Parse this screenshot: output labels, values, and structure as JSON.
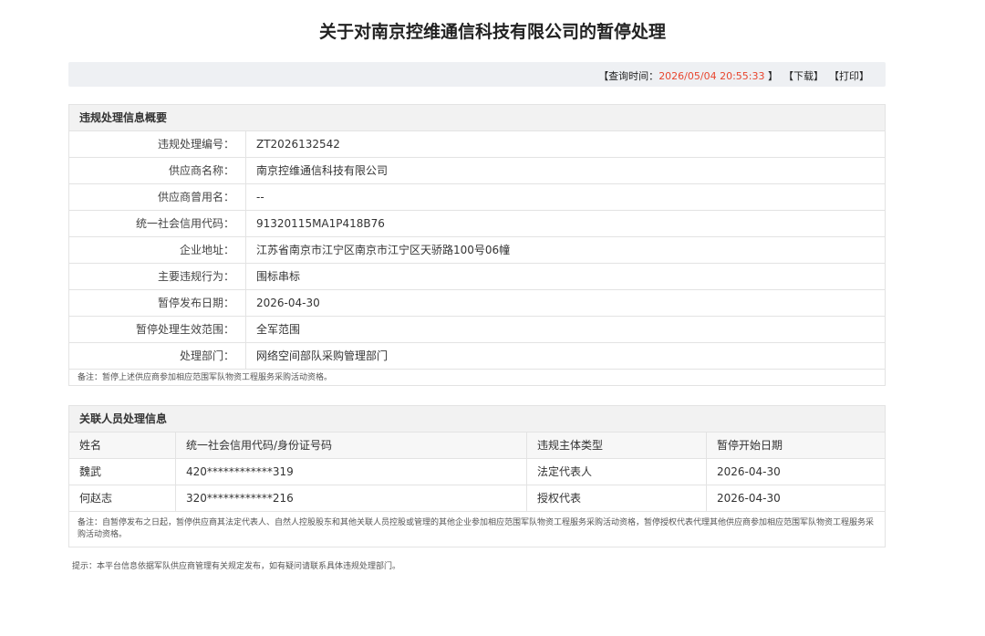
{
  "page": {
    "title": "关于对南京控维通信科技有限公司的暂停处理"
  },
  "query_bar": {
    "open_bracket": "【查询时间：",
    "time": "2026/05/04 20:55:33",
    "close_bracket": "】",
    "download_label": "【下载】",
    "print_label": "【打印】"
  },
  "summary": {
    "heading": "违规处理信息概要",
    "rows": [
      {
        "label": "违规处理编号：",
        "value": "ZT2026132542"
      },
      {
        "label": "供应商名称：",
        "value": "南京控维通信科技有限公司"
      },
      {
        "label": "供应商曾用名：",
        "value": "--"
      },
      {
        "label": "统一社会信用代码：",
        "value": "91320115MA1P418B76"
      },
      {
        "label": "企业地址：",
        "value": "江苏省南京市江宁区南京市江宁区天骄路100号06幢"
      },
      {
        "label": "主要违规行为：",
        "value": "围标串标"
      },
      {
        "label": "暂停发布日期：",
        "value": "2026-04-30"
      },
      {
        "label": "暂停处理生效范围：",
        "value": "全军范围"
      },
      {
        "label": "处理部门：",
        "value": "网络空间部队采购管理部门"
      }
    ],
    "note": "备注：暂停上述供应商参加相应范围军队物资工程服务采购活动资格。"
  },
  "related": {
    "heading": "关联人员处理信息",
    "columns": [
      "姓名",
      "统一社会信用代码/身份证号码",
      "违规主体类型",
      "暂停开始日期"
    ],
    "rows": [
      [
        "魏武",
        "420************319",
        "法定代表人",
        "2026-04-30"
      ],
      [
        "何赵志",
        "320************216",
        "授权代表",
        "2026-04-30"
      ]
    ],
    "note": "备注：自暂停发布之日起，暂停供应商其法定代表人、自然人控股股东和其他关联人员控股或管理的其他企业参加相应范围军队物资工程服务采购活动资格，暂停授权代表代理其他供应商参加相应范围军队物资工程服务采购活动资格。"
  },
  "footer": {
    "tip": "提示：本平台信息依据军队供应商管理有关规定发布，如有疑问请联系具体违规处理部门。"
  }
}
